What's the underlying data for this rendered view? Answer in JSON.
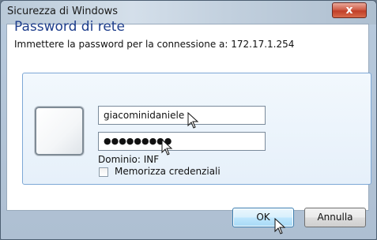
{
  "window": {
    "title": "Sicurezza di Windows",
    "close_glyph": "x"
  },
  "dialog": {
    "heading": "Password di rete",
    "subtitle": "Immettere la password per la connessione a: 172.17.1.254"
  },
  "credentials": {
    "username_value": "giacominidaniele",
    "password_masked": "●●●●●●●●●",
    "domain_label": "Dominio: INF",
    "remember_label": "Memorizza credenziali",
    "remember_checked": false
  },
  "buttons": {
    "ok_label": "OK",
    "cancel_label": "Annulla"
  },
  "icons": {
    "user_tile": "user-avatar-placeholder-icon",
    "cursor": "mouse-pointer-icon"
  },
  "colors": {
    "heading": "#1e3e8c",
    "tile_border": "#7ea8d6",
    "close_button": "#c03e28"
  }
}
